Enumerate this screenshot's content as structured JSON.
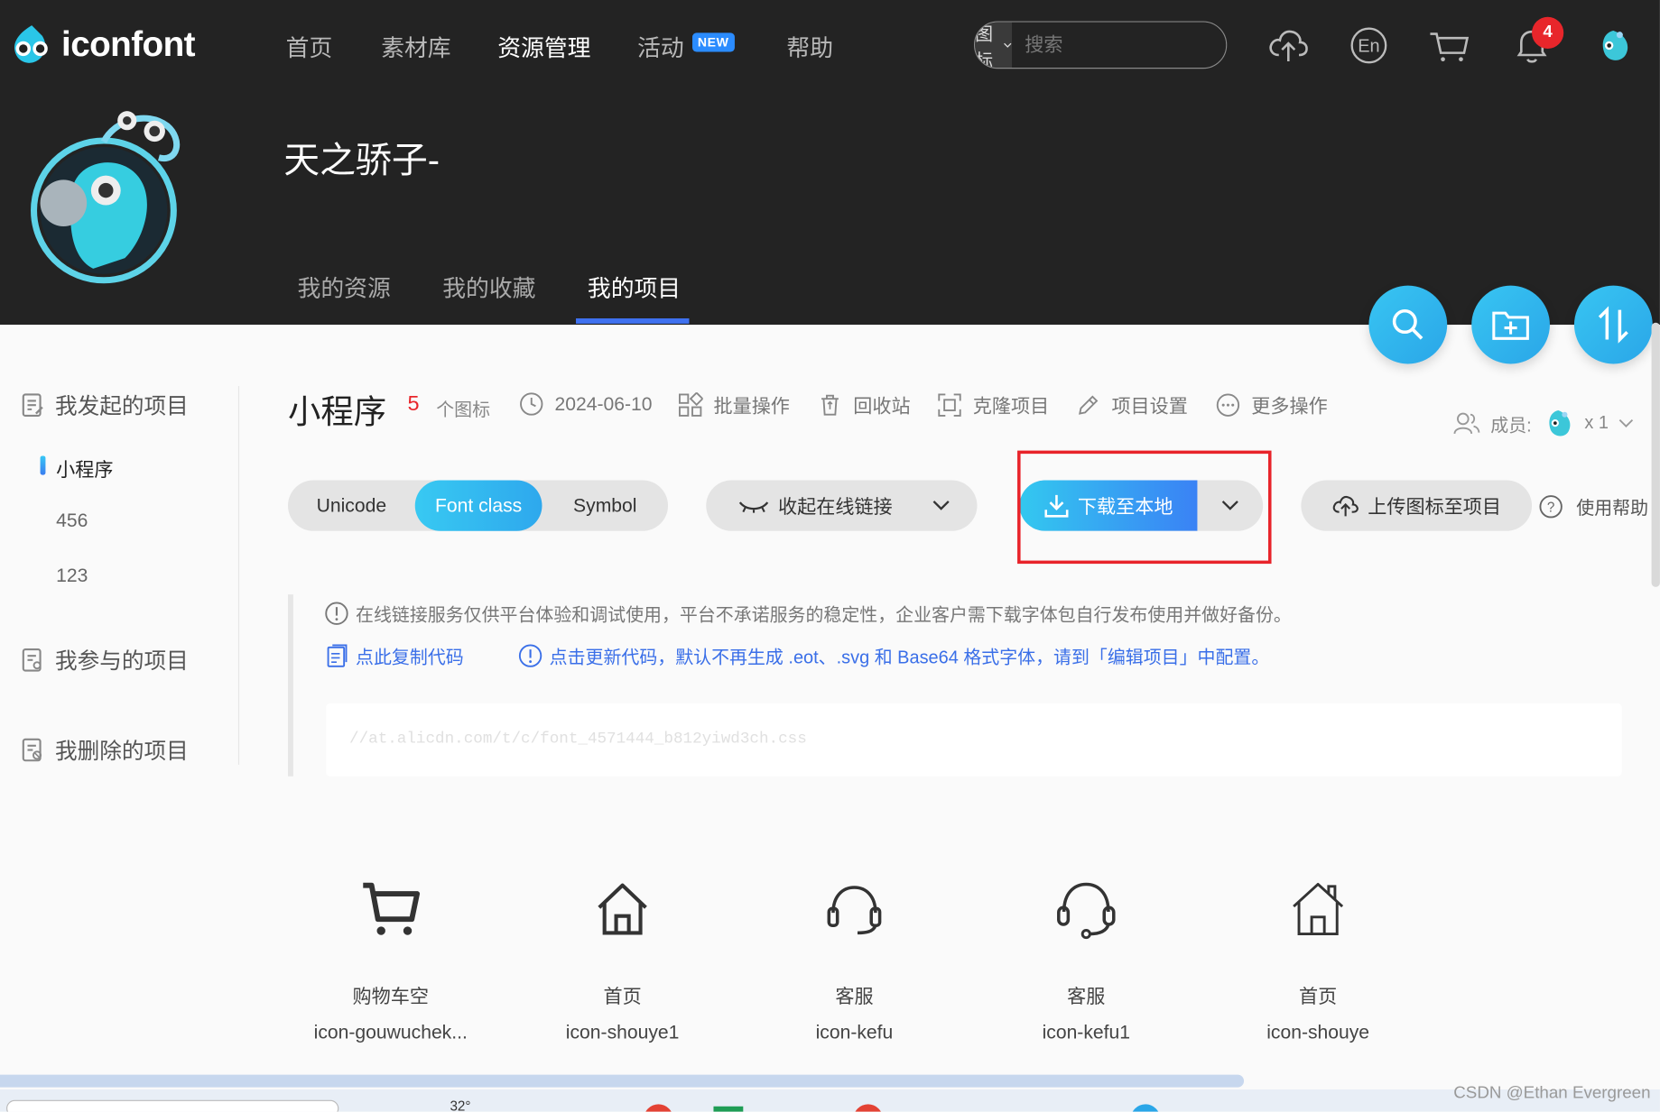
{
  "header": {
    "logo_text": "iconfont",
    "nav": [
      "首页",
      "素材库",
      "资源管理",
      "活动",
      "帮助"
    ],
    "nav_active": "资源管理",
    "new_badge": "NEW",
    "search_type": "图标",
    "search_placeholder": "搜索",
    "notification_count": "4"
  },
  "profile": {
    "username": "天之骄子-",
    "tabs": [
      "我的资源",
      "我的收藏",
      "我的项目"
    ],
    "active_tab": "我的项目"
  },
  "sidebar": {
    "created_projects": "我发起的项目",
    "projects": [
      "小程序",
      "456",
      "123"
    ],
    "joined_projects": "我参与的项目",
    "deleted_projects": "我删除的项目"
  },
  "project": {
    "title": "小程序",
    "icon_count": "5",
    "icon_count_label": "个图标",
    "date": "2024-06-10",
    "actions": [
      "批量操作",
      "回收站",
      "克隆项目",
      "项目设置",
      "更多操作"
    ],
    "members_label": "成员:",
    "members_count": "x 1"
  },
  "toolbar": {
    "modes": [
      "Unicode",
      "Font class",
      "Symbol"
    ],
    "active_mode": "Font class",
    "collapse_link": "收起在线链接",
    "download": "下载至本地",
    "upload": "上传图标至项目",
    "help": "使用帮助"
  },
  "notice": {
    "warning": "在线链接服务仅供平台体验和调试使用，平台不承诺服务的稳定性，企业客户需下载字体包自行发布使用并做好备份。",
    "copy_code": "点此复制代码",
    "update_code": "点击更新代码，默认不再生成 .eot、.svg 和 Base64 格式字体，请到「编辑项目」中配置。",
    "css_link": "//at.alicdn.com/t/c/font_4571444_b812yiwd3ch.css"
  },
  "icons": [
    {
      "name": "购物车空",
      "code": "icon-gouwuchek...",
      "glyph": "cart-icon"
    },
    {
      "name": "首页",
      "code": "icon-shouye1",
      "glyph": "home-filled-icon"
    },
    {
      "name": "客服",
      "code": "icon-kefu",
      "glyph": "headset-icon"
    },
    {
      "name": "客服",
      "code": "icon-kefu1",
      "glyph": "headset-outline-icon"
    },
    {
      "name": "首页",
      "code": "icon-shouye",
      "glyph": "home-outline-icon"
    }
  ],
  "taskbar": {
    "temperature": "32°"
  },
  "watermark": "CSDN @Ethan Evergreen",
  "colors": {
    "accent": "#2ea8ed",
    "highlight": "#e8232a",
    "link": "#3a6fe8",
    "header_bg": "#232323"
  }
}
